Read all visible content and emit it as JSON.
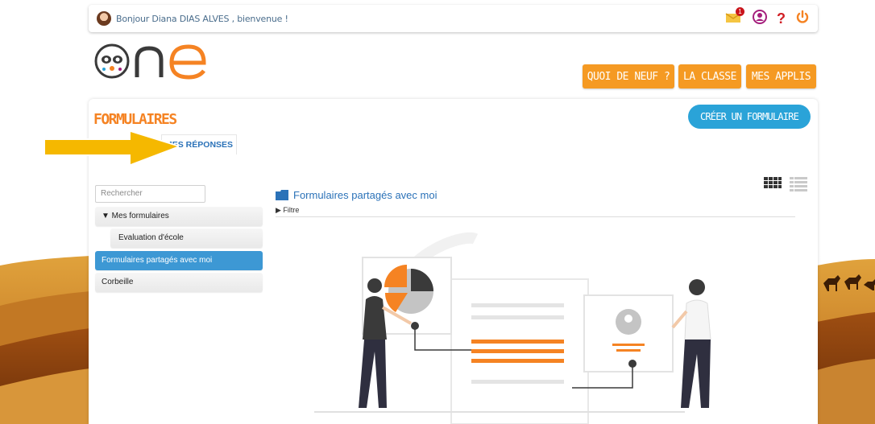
{
  "topbar": {
    "greeting": "Bonjour Diana DIAS ALVES , bienvenue !",
    "icons": [
      "mail-icon",
      "user-icon",
      "help-icon",
      "power-icon"
    ],
    "notification_count": "1"
  },
  "brand": {
    "logo_text": "one"
  },
  "nav": {
    "whats_new": "QUOI DE NEUF ?",
    "class": "LA CLASSE",
    "my_apps": "MES APPLIS"
  },
  "page": {
    "title": "FORMULAIRES",
    "create_button": "CRÉER UN FORMULAIRE",
    "tab_forms": "ES",
    "tab_responses": "MES RÉPONSES"
  },
  "sidebar": {
    "search_placeholder": "Rechercher",
    "items": [
      {
        "label": "▼ Mes formulaires"
      },
      {
        "label": "Evaluation d'école"
      },
      {
        "label": "Formulaires partagés avec moi"
      },
      {
        "label": "Corbeille"
      }
    ]
  },
  "main": {
    "folder_title": "Formulaires partagés avec moi",
    "filter_label": "▶ Filtre"
  },
  "colors": {
    "accent_orange": "#f59a23",
    "title_orange": "#f58323",
    "blue": "#2b72b8",
    "create_blue": "#2aa3d8",
    "active_blue": "#3d98d4"
  }
}
